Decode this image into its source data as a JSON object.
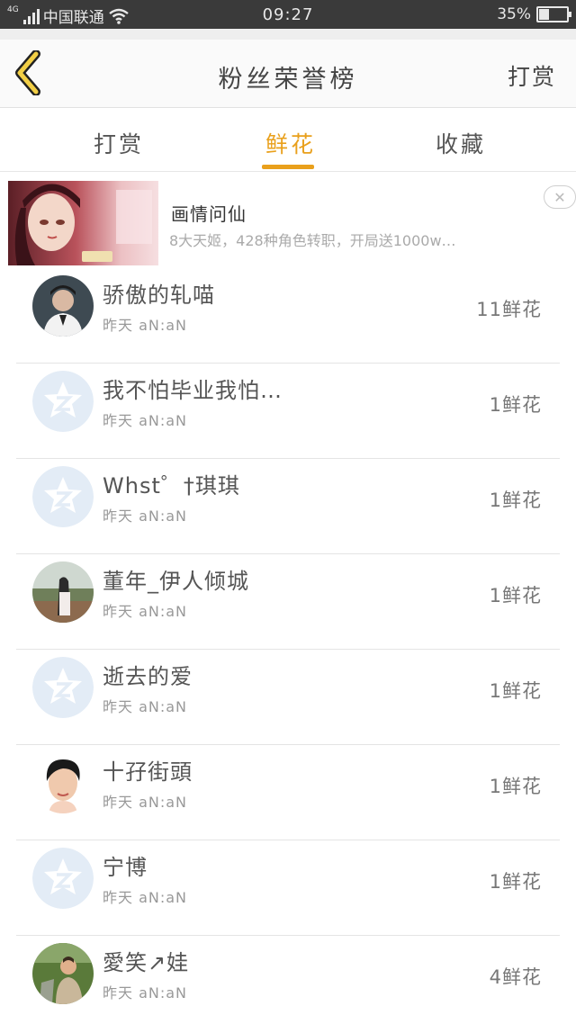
{
  "status_bar": {
    "network_tag": "4G",
    "carrier": "中国联通",
    "time": "09:27",
    "battery_percent_text": "35%",
    "battery_level": 0.35,
    "icons": [
      "signal-icon",
      "wifi-icon",
      "battery-icon"
    ]
  },
  "header": {
    "title": "粉丝荣誉榜",
    "back_icon": "chevron-left-icon",
    "reward_label": "打赏",
    "accent_color": "#e9a01c"
  },
  "tabs": [
    {
      "label": "打赏",
      "active": false
    },
    {
      "label": "鲜花",
      "active": true
    },
    {
      "label": "收藏",
      "active": false
    }
  ],
  "ad": {
    "title": "画情问仙",
    "description": "8大天姬，428种角色转职，开局送1000w…",
    "close_icon": "close-icon"
  },
  "fans": [
    {
      "name": "骄傲的轧喵",
      "time": "昨天 aN:aN",
      "count": "11鲜花",
      "avatar": "photo-dark"
    },
    {
      "name": "我不怕毕业我怕…",
      "time": "昨天 aN:aN",
      "count": "1鲜花",
      "avatar": "default-qq-icon"
    },
    {
      "name": "Whst゜†琪琪",
      "time": "昨天 aN:aN",
      "count": "1鲜花",
      "avatar": "default-qq-icon"
    },
    {
      "name": "董年_伊人倾城",
      "time": "昨天 aN:aN",
      "count": "1鲜花",
      "avatar": "photo-landscape"
    },
    {
      "name": "逝去的爱",
      "time": "昨天 aN:aN",
      "count": "1鲜花",
      "avatar": "default-qq-icon"
    },
    {
      "name": "十孖街頭",
      "time": "昨天 aN:aN",
      "count": "1鲜花",
      "avatar": "photo-portrait"
    },
    {
      "name": "宁博",
      "time": "昨天 aN:aN",
      "count": "1鲜花",
      "avatar": "default-qq-icon"
    },
    {
      "name": "愛笑↗娃",
      "time": "昨天 aN:aN",
      "count": "4鲜花",
      "avatar": "photo-outdoor"
    }
  ]
}
